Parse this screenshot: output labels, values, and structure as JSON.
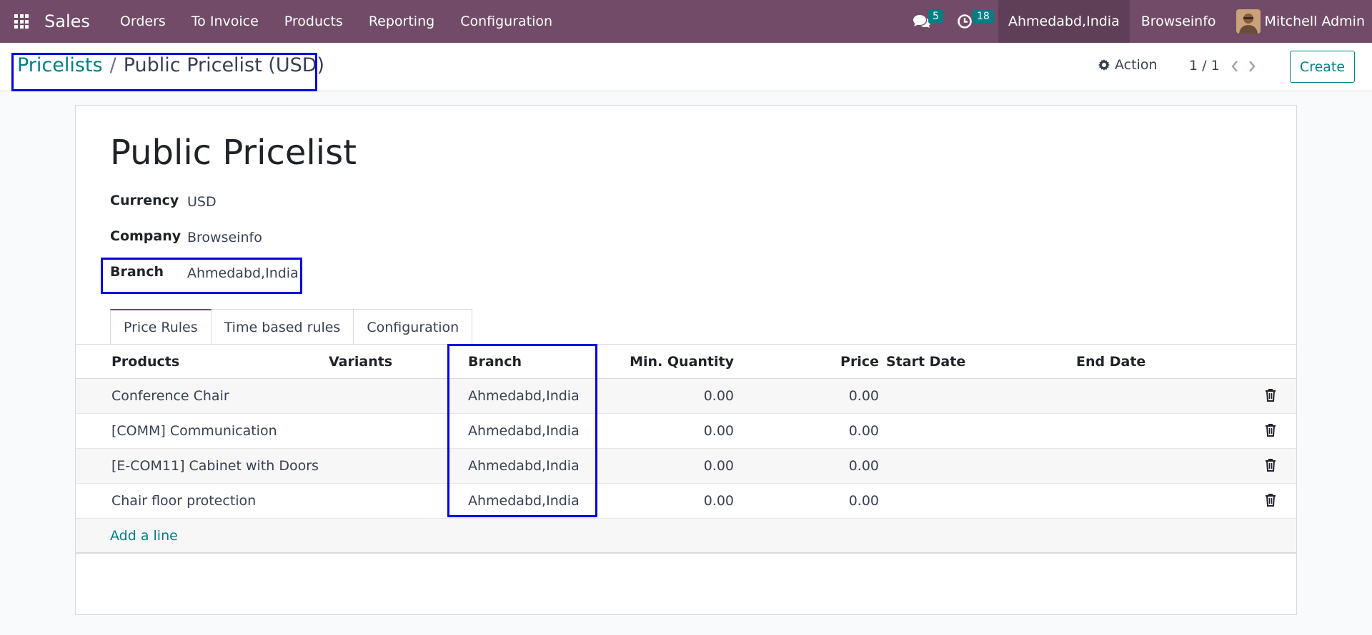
{
  "navbar": {
    "app_name": "Sales",
    "menu": [
      "Orders",
      "To Invoice",
      "Products",
      "Reporting",
      "Configuration"
    ],
    "messages_count": "5",
    "activities_count": "18",
    "branch": "Ahmedabd,India",
    "company": "Browseinfo",
    "user": "Mitchell Admin"
  },
  "control_panel": {
    "breadcrumb_parent": "Pricelists",
    "breadcrumb_separator": "/",
    "breadcrumb_current": "Public Pricelist (USD)",
    "action_label": "Action",
    "pager": "1 / 1",
    "create_label": "Create"
  },
  "form": {
    "title": "Public Pricelist",
    "fields": {
      "currency_label": "Currency",
      "currency_value": "USD",
      "company_label": "Company",
      "company_value": "Browseinfo",
      "branch_label": "Branch",
      "branch_value": "Ahmedabd,India"
    },
    "tabs": [
      "Price Rules",
      "Time based rules",
      "Configuration"
    ],
    "active_tab": "Price Rules",
    "columns": {
      "products": "Products",
      "variants": "Variants",
      "branch": "Branch",
      "min_qty": "Min. Quantity",
      "price": "Price",
      "start_date": "Start Date",
      "end_date": "End Date"
    },
    "rows": [
      {
        "product": "Conference Chair",
        "variant": "",
        "branch": "Ahmedabd,India",
        "min_qty": "0.00",
        "price": "0.00",
        "start": "",
        "end": ""
      },
      {
        "product": "[COMM] Communication",
        "variant": "",
        "branch": "Ahmedabd,India",
        "min_qty": "0.00",
        "price": "0.00",
        "start": "",
        "end": ""
      },
      {
        "product": "[E-COM11] Cabinet with Doors",
        "variant": "",
        "branch": "Ahmedabd,India",
        "min_qty": "0.00",
        "price": "0.00",
        "start": "",
        "end": ""
      },
      {
        "product": "Chair floor protection",
        "variant": "",
        "branch": "Ahmedabd,India",
        "min_qty": "0.00",
        "price": "0.00",
        "start": "",
        "end": ""
      }
    ],
    "add_line_label": "Add a line"
  },
  "colors": {
    "navbar": "#714b67",
    "accent": "#017e84",
    "highlight": "#0000e0"
  }
}
